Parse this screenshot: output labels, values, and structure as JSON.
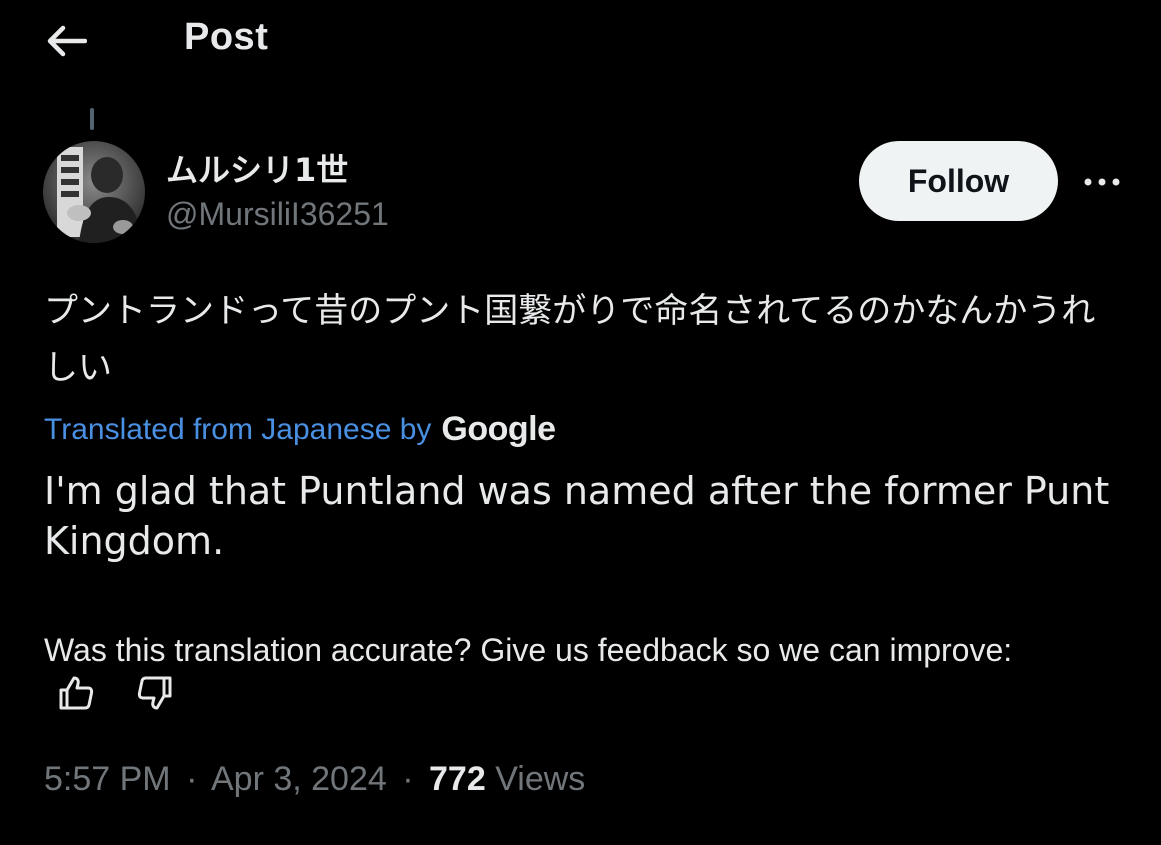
{
  "header": {
    "title": "Post",
    "back_icon": "arrow-left-icon"
  },
  "author": {
    "name": "ムルシリ1世",
    "handle": "@MursiliI36251",
    "follow_label": "Follow",
    "more_icon": "more-horizontal-icon"
  },
  "post": {
    "original_text": "プントランドって昔のプント国繋がりで命名されてるのかなんかうれしい",
    "translated_label": "Translated from Japanese by",
    "translation_provider": "Google",
    "translated_text": "I'm glad that Puntland was named after the former Punt Kingdom.",
    "feedback_text": "Was this translation accurate? Give us feedback so we can improve:",
    "time": "5:57 PM",
    "date": "Apr 3, 2024",
    "views_count": "772",
    "views_label": "Views",
    "separator": "·"
  },
  "colors": {
    "background": "#000000",
    "primary_text": "#e7e9ea",
    "secondary_text": "#71767b",
    "link": "#4a90e2",
    "follow_bg": "#eff3f4"
  }
}
